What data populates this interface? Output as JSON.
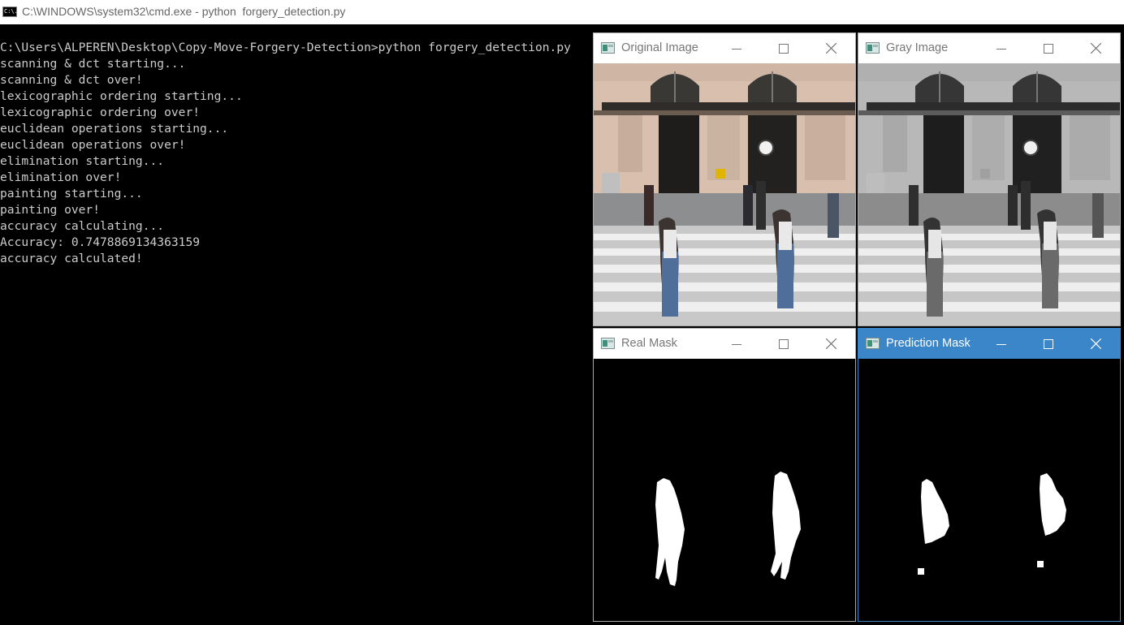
{
  "cmd": {
    "title": "C:\\WINDOWS\\system32\\cmd.exe - python  forgery_detection.py",
    "icon_label": "C:\\.",
    "lines": [
      "C:\\Users\\ALPEREN\\Desktop\\Copy-Move-Forgery-Detection>python forgery_detection.py",
      "scanning & dct starting...",
      "scanning & dct over!",
      "lexicographic ordering starting...",
      "lexicographic ordering over!",
      "euclidean operations starting...",
      "euclidean operations over!",
      "elimination starting...",
      "elimination over!",
      "painting starting...",
      "painting over!",
      "accuracy calculating...",
      "Accuracy: 0.7478869134363159",
      "accuracy calculated!"
    ]
  },
  "windows": {
    "original": {
      "title": "Original Image"
    },
    "gray": {
      "title": "Gray Image"
    },
    "real_mask": {
      "title": "Real Mask"
    },
    "prediction_mask": {
      "title": "Prediction Mask"
    }
  },
  "colors": {
    "terminal_bg": "#000000",
    "terminal_text": "#cccccc",
    "active_titlebar": "#3b86c9"
  }
}
